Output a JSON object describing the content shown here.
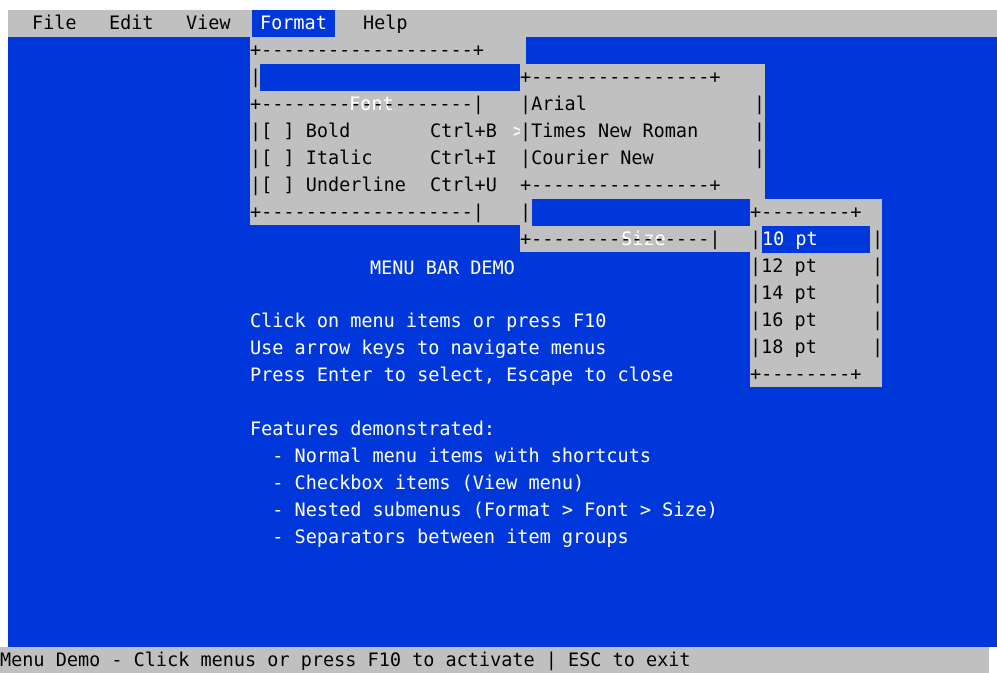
{
  "menubar": {
    "items": [
      {
        "label": "File"
      },
      {
        "label": "Edit"
      },
      {
        "label": "View"
      },
      {
        "label": "Format"
      },
      {
        "label": "Help"
      }
    ]
  },
  "format_menu": {
    "font_label": "Font",
    "font_arrow": ">",
    "border_top": "+-------------------+",
    "separator": "+-------------------|",
    "bottom": "+-------------------|",
    "items": [
      {
        "check": "[ ]",
        "label": "Bold",
        "shortcut": "Ctrl+B"
      },
      {
        "check": "[ ]",
        "label": "Italic",
        "shortcut": "Ctrl+I"
      },
      {
        "check": "[ ]",
        "label": "Underline",
        "shortcut": "Ctrl+U"
      }
    ]
  },
  "font_menu": {
    "border_top": "+----------------+",
    "items": [
      "Arial",
      "Times New Roman",
      "Courier New"
    ],
    "separator": "+----------------+",
    "size_label": "Size",
    "size_arrow": ">",
    "bottom": "+----------------|"
  },
  "size_menu": {
    "border_top": "+--------+",
    "items": [
      "10 pt",
      "12 pt",
      "14 pt",
      "16 pt",
      "18 pt"
    ],
    "bottom": "+--------+"
  },
  "body": {
    "title": "MENU BAR DEMO",
    "lines": [
      "Click on menu items or press F10",
      "Use arrow keys to navigate menus",
      "Press Enter to select, Escape to close"
    ],
    "features_heading": "Features demonstrated:",
    "features": [
      "  - Normal menu items with shortcuts",
      "  - Checkbox items (View menu)",
      "  - Nested submenus (Format > Font > Size)",
      "  - Separators between item groups"
    ]
  },
  "status": {
    "text": "Menu Demo - Click menus or press F10 to activate | ESC to exit"
  }
}
